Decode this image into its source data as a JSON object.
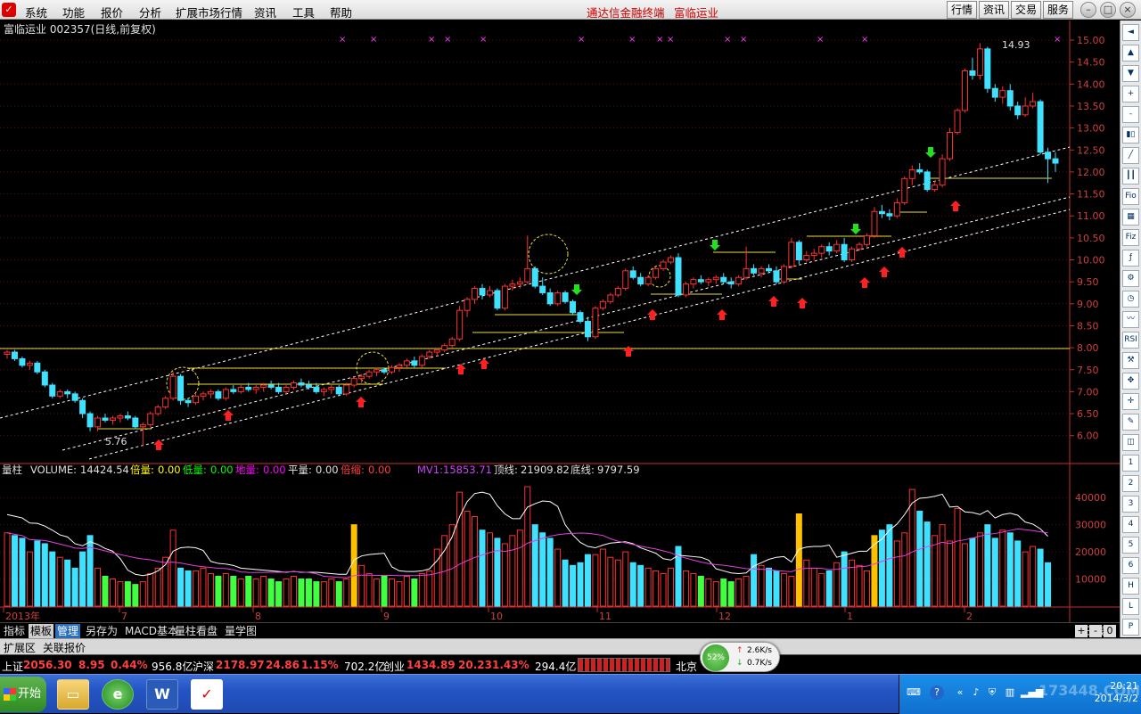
{
  "menu": {
    "items": [
      "系统",
      "功能",
      "报价",
      "分析",
      "扩展市场行情",
      "资讯",
      "工具",
      "帮助"
    ],
    "center_title": "通达信金融终端",
    "center_stock": "富临运业",
    "right_buttons": [
      "行情",
      "资讯",
      "交易",
      "服务"
    ]
  },
  "header": {
    "stock_title": "富临运业 002357(日线,前复权)"
  },
  "price_axis": {
    "labels": [
      "15.00",
      "14.50",
      "14.00",
      "13.50",
      "13.00",
      "12.50",
      "12.00",
      "11.50",
      "11.00",
      "10.50",
      "10.00",
      "9.50",
      "9.00",
      "8.50",
      "8.00",
      "7.50",
      "7.00",
      "6.50",
      "6.00"
    ]
  },
  "annotations": {
    "high": "14.93",
    "low": "5.76"
  },
  "volume_header": {
    "title": "量柱",
    "volume_label": "VOLUME:",
    "volume_value": "14424.54",
    "beiliang_label": "倍量:",
    "beiliang_value": "0.00",
    "diliang_label": "低量:",
    "diliang_value": "0.00",
    "diliang2_label": "地量:",
    "diliang2_value": "0.00",
    "pingliang_label": "平量:",
    "pingliang_value": "0.00",
    "beisuo_label": "倍缩:",
    "beisuo_value": "0.00",
    "mv1_label": "MV1:",
    "mv1_value": "15853.71",
    "dingxian_label": "顶线:",
    "dingxian_value": "21909.82",
    "dixian_label": "底线:",
    "dixian_value": "9797.59"
  },
  "volume_axis": {
    "labels": [
      "40000",
      "30000",
      "20000",
      "10000"
    ]
  },
  "date_axis": {
    "labels": [
      "2013年",
      "7",
      "8",
      "9",
      "10",
      "11",
      "12",
      "1",
      "2"
    ],
    "period": "日线"
  },
  "bottom_tabs": [
    "指标",
    "模板",
    "管理",
    "另存为",
    "MACD基本",
    "量柱看盘",
    "量学图"
  ],
  "sub_tabs": [
    "扩展区",
    "关联报价"
  ],
  "status": {
    "sh_label": "上证",
    "sh_index": "2056.30",
    "sh_change": "8.95",
    "sh_pct": "0.44%",
    "sh_amount": "956.8亿",
    "sz_label": "沪深",
    "sz_index": "2178.97",
    "sz_change": "24.86",
    "sz_pct": "1.15%",
    "sz_amount": "702.2亿",
    "cy_label": "创业",
    "cy_index": "1434.89",
    "cy_change": "20.23",
    "cy_pct": "1.43%",
    "cy_amount": "294.4亿",
    "location": "北京"
  },
  "speed": {
    "percent": "52%",
    "up": "2.6K/s",
    "down": "0.7K/s"
  },
  "taskbar": {
    "start_label": "开始",
    "clock": "20:21",
    "date": "2014/3/2",
    "watermark": "173448.COM"
  },
  "right_toolbar": [
    "◄",
    "▲",
    "▼",
    "+",
    "-",
    "Fio",
    "Fiz",
    "RSI"
  ],
  "chart_data": {
    "type": "candlestick",
    "y_range": [
      5.5,
      15.2
    ],
    "candles": [
      [
        7.85,
        7.95,
        7.75,
        7.9
      ],
      [
        7.9,
        7.95,
        7.7,
        7.75
      ],
      [
        7.75,
        7.8,
        7.55,
        7.6
      ],
      [
        7.6,
        7.7,
        7.5,
        7.65
      ],
      [
        7.65,
        7.7,
        7.4,
        7.45
      ],
      [
        7.45,
        7.5,
        7.1,
        7.15
      ],
      [
        7.15,
        7.2,
        6.85,
        6.9
      ],
      [
        6.9,
        7.05,
        6.85,
        7.0
      ],
      [
        7.0,
        7.05,
        6.85,
        6.95
      ],
      [
        6.95,
        7.0,
        6.75,
        6.8
      ],
      [
        6.8,
        6.85,
        6.4,
        6.5
      ],
      [
        6.5,
        6.55,
        6.1,
        6.2
      ],
      [
        6.2,
        6.45,
        6.1,
        6.4
      ],
      [
        6.4,
        6.5,
        6.3,
        6.35
      ],
      [
        6.35,
        6.45,
        6.25,
        6.4
      ],
      [
        6.4,
        6.5,
        6.3,
        6.45
      ],
      [
        6.45,
        6.55,
        6.35,
        6.4
      ],
      [
        6.4,
        6.45,
        6.15,
        6.2
      ],
      [
        6.2,
        6.3,
        5.76,
        6.25
      ],
      [
        6.25,
        6.55,
        6.2,
        6.5
      ],
      [
        6.5,
        6.7,
        6.45,
        6.65
      ],
      [
        6.65,
        6.9,
        6.6,
        6.85
      ],
      [
        6.85,
        7.45,
        6.8,
        7.35
      ],
      [
        7.35,
        7.4,
        6.7,
        6.8
      ],
      [
        6.8,
        6.85,
        6.65,
        6.75
      ],
      [
        6.75,
        6.95,
        6.7,
        6.9
      ],
      [
        6.9,
        7.0,
        6.8,
        6.95
      ],
      [
        6.95,
        7.05,
        6.85,
        7.0
      ],
      [
        7.0,
        7.05,
        6.8,
        6.85
      ],
      [
        6.85,
        7.1,
        6.8,
        7.05
      ],
      [
        7.05,
        7.15,
        6.95,
        7.0
      ],
      [
        7.0,
        7.15,
        6.95,
        7.1
      ],
      [
        7.1,
        7.2,
        7.0,
        7.05
      ],
      [
        7.05,
        7.15,
        6.95,
        7.1
      ],
      [
        7.1,
        7.2,
        7.0,
        7.15
      ],
      [
        7.15,
        7.25,
        7.05,
        7.1
      ],
      [
        7.1,
        7.2,
        6.95,
        7.0
      ],
      [
        7.0,
        7.15,
        6.95,
        7.1
      ],
      [
        7.1,
        7.25,
        7.05,
        7.2
      ],
      [
        7.2,
        7.3,
        7.1,
        7.15
      ],
      [
        7.15,
        7.25,
        7.05,
        7.1
      ],
      [
        7.1,
        7.2,
        6.95,
        7.0
      ],
      [
        7.0,
        7.1,
        6.9,
        7.05
      ],
      [
        7.05,
        7.15,
        6.95,
        7.1
      ],
      [
        7.1,
        7.15,
        6.9,
        6.95
      ],
      [
        6.95,
        7.2,
        6.9,
        7.15
      ],
      [
        7.15,
        7.35,
        7.1,
        7.3
      ],
      [
        7.3,
        7.4,
        7.2,
        7.35
      ],
      [
        7.35,
        7.5,
        7.3,
        7.45
      ],
      [
        7.45,
        7.55,
        7.35,
        7.5
      ],
      [
        7.5,
        7.55,
        7.4,
        7.45
      ],
      [
        7.45,
        7.6,
        7.4,
        7.55
      ],
      [
        7.55,
        7.65,
        7.45,
        7.6
      ],
      [
        7.6,
        7.75,
        7.55,
        7.7
      ],
      [
        7.7,
        7.8,
        7.55,
        7.6
      ],
      [
        7.6,
        7.85,
        7.55,
        7.8
      ],
      [
        7.8,
        7.95,
        7.75,
        7.9
      ],
      [
        7.9,
        8.0,
        7.8,
        7.95
      ],
      [
        7.95,
        8.1,
        7.9,
        8.05
      ],
      [
        8.05,
        8.25,
        8.0,
        8.2
      ],
      [
        8.2,
        8.95,
        8.15,
        8.85
      ],
      [
        8.85,
        9.15,
        8.7,
        9.1
      ],
      [
        9.1,
        9.4,
        9.0,
        9.35
      ],
      [
        9.35,
        9.45,
        9.1,
        9.2
      ],
      [
        9.2,
        9.4,
        9.15,
        9.3
      ],
      [
        9.3,
        9.35,
        8.85,
        8.9
      ],
      [
        8.9,
        9.45,
        8.85,
        9.4
      ],
      [
        9.4,
        9.55,
        9.3,
        9.45
      ],
      [
        9.45,
        9.6,
        9.35,
        9.5
      ],
      [
        9.5,
        10.55,
        9.45,
        9.8
      ],
      [
        9.8,
        9.85,
        9.35,
        9.4
      ],
      [
        9.4,
        9.6,
        9.2,
        9.25
      ],
      [
        9.25,
        9.35,
        8.95,
        9.0
      ],
      [
        9.0,
        9.3,
        8.95,
        9.25
      ],
      [
        9.25,
        9.3,
        9.0,
        9.05
      ],
      [
        9.05,
        9.1,
        8.75,
        8.8
      ],
      [
        8.8,
        8.85,
        8.55,
        8.6
      ],
      [
        8.6,
        8.7,
        8.15,
        8.25
      ],
      [
        8.25,
        8.95,
        8.2,
        8.9
      ],
      [
        8.9,
        9.1,
        8.85,
        9.05
      ],
      [
        9.05,
        9.25,
        9.0,
        9.2
      ],
      [
        9.2,
        9.4,
        9.15,
        9.35
      ],
      [
        9.35,
        9.8,
        9.3,
        9.75
      ],
      [
        9.75,
        9.85,
        9.55,
        9.6
      ],
      [
        9.6,
        9.7,
        9.4,
        9.45
      ],
      [
        9.45,
        9.65,
        9.4,
        9.6
      ],
      [
        9.6,
        9.85,
        9.55,
        9.8
      ],
      [
        9.8,
        10.0,
        9.75,
        9.95
      ],
      [
        9.95,
        10.1,
        9.9,
        10.05
      ],
      [
        10.05,
        10.15,
        9.15,
        9.2
      ],
      [
        9.2,
        9.5,
        9.15,
        9.45
      ],
      [
        9.45,
        9.6,
        9.35,
        9.55
      ],
      [
        9.55,
        9.65,
        9.45,
        9.5
      ],
      [
        9.5,
        9.6,
        9.4,
        9.55
      ],
      [
        9.55,
        9.65,
        9.45,
        9.6
      ],
      [
        9.6,
        9.7,
        9.45,
        9.5
      ],
      [
        9.5,
        9.6,
        9.35,
        9.45
      ],
      [
        9.45,
        9.65,
        9.4,
        9.6
      ],
      [
        9.6,
        10.3,
        9.55,
        9.8
      ],
      [
        9.8,
        9.9,
        9.65,
        9.7
      ],
      [
        9.7,
        9.85,
        9.6,
        9.8
      ],
      [
        9.8,
        9.9,
        9.7,
        9.75
      ],
      [
        9.75,
        9.85,
        9.45,
        9.5
      ],
      [
        9.5,
        9.9,
        9.45,
        9.85
      ],
      [
        9.85,
        10.5,
        9.8,
        10.4
      ],
      [
        10.4,
        10.45,
        9.9,
        10.0
      ],
      [
        10.0,
        10.2,
        9.95,
        10.1
      ],
      [
        10.1,
        10.25,
        10.0,
        10.15
      ],
      [
        10.15,
        10.35,
        10.05,
        10.3
      ],
      [
        10.3,
        10.4,
        10.1,
        10.2
      ],
      [
        10.2,
        10.45,
        10.15,
        10.35
      ],
      [
        10.35,
        10.5,
        9.95,
        10.0
      ],
      [
        10.0,
        10.3,
        9.95,
        10.25
      ],
      [
        10.25,
        10.4,
        10.2,
        10.35
      ],
      [
        10.35,
        10.6,
        10.3,
        10.55
      ],
      [
        10.55,
        11.2,
        10.5,
        11.1
      ],
      [
        11.1,
        11.25,
        10.95,
        11.05
      ],
      [
        11.05,
        11.15,
        10.9,
        11.0
      ],
      [
        11.0,
        11.4,
        10.95,
        11.3
      ],
      [
        11.3,
        11.9,
        11.25,
        11.85
      ],
      [
        11.85,
        12.15,
        11.7,
        12.05
      ],
      [
        12.05,
        12.2,
        11.95,
        12.0
      ],
      [
        12.0,
        12.05,
        11.55,
        11.6
      ],
      [
        11.6,
        11.8,
        11.55,
        11.7
      ],
      [
        11.7,
        12.4,
        11.65,
        12.3
      ],
      [
        12.3,
        13.0,
        12.25,
        12.9
      ],
      [
        12.9,
        13.45,
        12.85,
        13.4
      ],
      [
        13.4,
        14.35,
        13.35,
        14.3
      ],
      [
        14.3,
        14.6,
        14.1,
        14.2
      ],
      [
        14.2,
        14.93,
        14.1,
        14.8
      ],
      [
        14.8,
        14.85,
        13.8,
        13.9
      ],
      [
        13.9,
        14.0,
        13.6,
        13.7
      ],
      [
        13.7,
        13.95,
        13.55,
        13.85
      ],
      [
        13.85,
        14.0,
        13.4,
        13.5
      ],
      [
        13.5,
        13.6,
        13.2,
        13.3
      ],
      [
        13.3,
        13.7,
        13.25,
        13.5
      ],
      [
        13.5,
        13.8,
        13.45,
        13.6
      ],
      [
        13.6,
        13.65,
        12.4,
        12.45
      ],
      [
        12.45,
        12.55,
        11.75,
        12.3
      ],
      [
        12.3,
        12.45,
        12.0,
        12.2
      ]
    ],
    "volume": {
      "ylim": [
        0,
        45000
      ],
      "bars": [
        27000,
        26000,
        25000,
        20000,
        24000,
        23000,
        20000,
        18000,
        17000,
        14000,
        20000,
        26000,
        14000,
        11000,
        10000,
        9000,
        9000,
        8000,
        9000,
        12000,
        14000,
        18000,
        28000,
        14000,
        13000,
        13000,
        14000,
        12000,
        11000,
        12000,
        11000,
        10000,
        11000,
        10000,
        11000,
        10000,
        9000,
        10000,
        11000,
        10000,
        10000,
        9000,
        9000,
        10000,
        9000,
        10000,
        30000,
        15000,
        12000,
        10000,
        11000,
        10000,
        9000,
        11000,
        10000,
        12000,
        13000,
        21000,
        26000,
        30000,
        42000,
        35000,
        33000,
        28000,
        27000,
        25000,
        23000,
        26000,
        28000,
        44000,
        30000,
        27000,
        25000,
        21000,
        17000,
        15000,
        16000,
        19000,
        19000,
        21000,
        18000,
        17000,
        20000,
        16000,
        15000,
        14000,
        13000,
        12000,
        14000,
        22000,
        13000,
        12000,
        11000,
        10000,
        9000,
        10000,
        9000,
        10000,
        11000,
        19000,
        15000,
        14000,
        13000,
        12000,
        11000,
        34000,
        17000,
        14000,
        12000,
        13000,
        16000,
        20000,
        17000,
        15000,
        13000,
        26000,
        28000,
        30000,
        24000,
        27000,
        43000,
        35000,
        31000,
        26000,
        30000,
        24000,
        36000,
        23000,
        25000,
        27000,
        30000,
        25000,
        28000,
        27000,
        24000,
        20000,
        22000,
        21000,
        16000
      ],
      "mv1": 15853.71,
      "top_line": 21909.82,
      "bottom_line": 9797.59
    }
  }
}
